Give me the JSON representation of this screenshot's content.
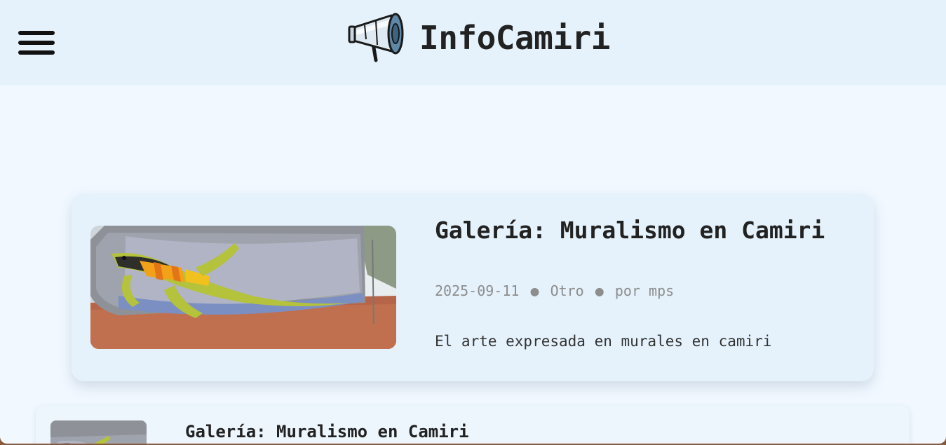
{
  "site": {
    "title": "InfoCamiri",
    "logo_icon": "megaphone-icon",
    "menu_icon": "hamburger-menu-icon"
  },
  "featured_post": {
    "title": "Galería: Muralismo en Camiri",
    "date": "2025-09-11",
    "category": "Otro",
    "author": "por mps",
    "separator": "●",
    "excerpt": "El arte expresada en murales en camiri",
    "image_icon": "mural-lizard-photo"
  },
  "posts": [
    {
      "title": "Galería: Muralismo en Camiri",
      "image_icon": "mural-lizard-photo"
    }
  ],
  "colors": {
    "header_bg": "#e5f2fb",
    "page_bg": "#f1f8ff",
    "card_bg": "#e5f2fb",
    "meta_text": "#8d8d8d"
  }
}
